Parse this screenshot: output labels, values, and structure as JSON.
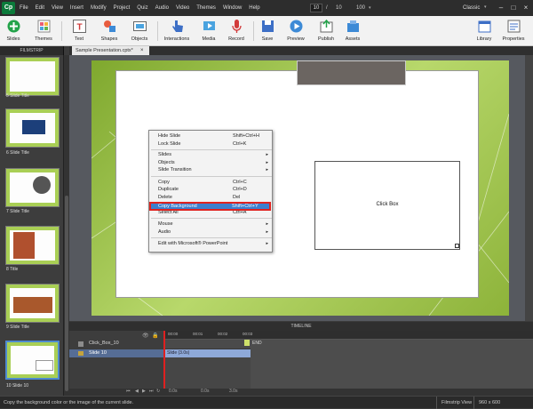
{
  "menu": [
    "File",
    "Edit",
    "View",
    "Insert",
    "Modify",
    "Project",
    "Quiz",
    "Audio",
    "Video",
    "Themes",
    "Window",
    "Help"
  ],
  "logo": "Cp",
  "page": {
    "current": "10",
    "separator": "/",
    "total": "10"
  },
  "zoom": "100",
  "workspace": "Classic",
  "toolbar": {
    "slides": "Slides",
    "themes": "Themes",
    "text": "Text",
    "shapes": "Shapes",
    "objects": "Objects",
    "interactions": "Interactions",
    "media": "Media",
    "record": "Record",
    "save": "Save",
    "preview": "Preview",
    "publish": "Publish",
    "assets": "Assets",
    "library": "Library",
    "properties": "Properties"
  },
  "filmstrip": {
    "header": "FILMSTRIP",
    "labels": [
      "5 Slide Title",
      "6 Slide Title",
      "7 Slide Title",
      "8 Title",
      "9 Slide Title",
      "10 Slide 10"
    ]
  },
  "tab": {
    "title": "Sample Presentation.cptx*",
    "close": "×"
  },
  "slide": {
    "clickbox": "Click Box"
  },
  "context_menu": [
    {
      "label": "Hide Slide",
      "shortcut": "Shift+Ctrl+H"
    },
    {
      "label": "Lock Slide",
      "shortcut": "Ctrl+K"
    },
    {
      "label": "Slides",
      "shortcut": "",
      "arrow": "▸"
    },
    {
      "label": "Objects",
      "shortcut": "",
      "arrow": "▸"
    },
    {
      "label": "Slide Transition",
      "shortcut": "",
      "arrow": "▸"
    },
    {
      "label": "Copy",
      "shortcut": "Ctrl+C"
    },
    {
      "label": "Duplicate",
      "shortcut": "Ctrl+D"
    },
    {
      "label": "Delete",
      "shortcut": "Del"
    },
    {
      "label": "Copy Background",
      "shortcut": "Shift+Ctrl+Y"
    },
    {
      "label": "Select All",
      "shortcut": "Ctrl+A"
    },
    {
      "label": "Mouse",
      "shortcut": "",
      "arrow": "▸"
    },
    {
      "label": "Audio",
      "shortcut": "",
      "arrow": "▸"
    },
    {
      "label": "Edit with Microsoft® PowerPoint",
      "shortcut": "",
      "arrow": "▸"
    }
  ],
  "timeline": {
    "header": "TIMELINE",
    "layers": [
      {
        "name": "Click_Box_10"
      },
      {
        "name": "Slide 10"
      }
    ],
    "ruler": [
      "00:00",
      "00:01",
      "00:02",
      "00:03"
    ],
    "bar": "Slide (3.0s)",
    "end": "END",
    "controls": {
      "time1": "0.0s",
      "time2": "0.0s",
      "time3": "3.0s"
    }
  },
  "status": {
    "hint": "Copy the background color or the image of the current slide.",
    "view": "Filmstrip View",
    "size": "960 x 600"
  },
  "colors": {
    "highlight": "#3c7fce",
    "outline": "#e0231f",
    "slideGreen": "#a9cf55"
  }
}
